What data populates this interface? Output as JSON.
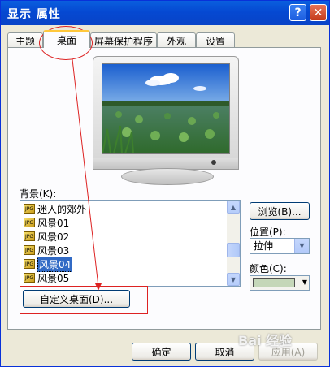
{
  "window": {
    "title": "显示 属性",
    "help_icon": "?",
    "close_icon": "✕"
  },
  "tabs": [
    {
      "label": "主题"
    },
    {
      "label": "桌面"
    },
    {
      "label": "屏幕保护程序"
    },
    {
      "label": "外观"
    },
    {
      "label": "设置"
    }
  ],
  "background": {
    "label": "背景(K):",
    "items": [
      {
        "label": "迷人的郊外"
      },
      {
        "label": "风景01"
      },
      {
        "label": "风景02"
      },
      {
        "label": "风景03"
      },
      {
        "label": "风景04"
      },
      {
        "label": "风景05"
      }
    ],
    "selected": "风景04"
  },
  "browse_label": "浏览(B)...",
  "position": {
    "label": "位置(P):",
    "value": "拉伸"
  },
  "color": {
    "label": "颜色(C):",
    "value": "#c5d7b8"
  },
  "customize_label": "自定义桌面(D)...",
  "footer": {
    "ok": "确定",
    "cancel": "取消",
    "apply": "应用(A)"
  },
  "watermark": "Bai 经验"
}
